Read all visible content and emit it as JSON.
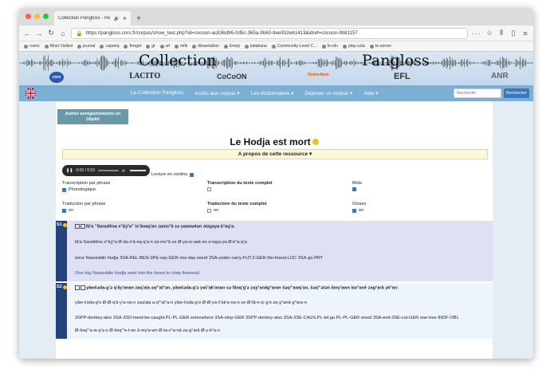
{
  "browser": {
    "tab_title": "Collection Pangloss - Ressource",
    "url": "https://pangloss.cnrs.fr/corpus/show_text.php?id=cocoon-ac836d96-0d5c-365a-9b60-8ee932e61413&idref=cocoon-9b81157",
    "bookmarks": [
      "nums",
      "Most Visited",
      "journal",
      "capoeq",
      "frmget",
      "gr",
      "wf",
      "milk",
      "dissertation",
      "Emoji",
      "katakana",
      "Community-Level C...",
      "fs-rdu",
      "play-uzla",
      "to-server"
    ]
  },
  "banner": {
    "title_left": "Collection",
    "title_right": "Pangloss",
    "logos": [
      "cnrs",
      "LACITO",
      "CoCoON",
      "Huma-Num",
      "EFL",
      "ANR"
    ]
  },
  "menu": {
    "items": [
      "La Collection Pangloss",
      "Accès aux corpus ▾",
      "Les dictionnaires ▾",
      "Déposer un corpus ▾",
      "Aide ▾"
    ],
    "search_placeholder": "Recherche",
    "search_button": "Rechercher"
  },
  "content": {
    "other_recordings": "Autres enregistrements en Ubykh",
    "title": "Le Hodja est mort",
    "apropos": "A propos de cette ressource ▾",
    "player_time": "0:00 / 0:03",
    "continuous": "Lecture en continu",
    "options": {
      "transcription_phrase": "Transcription par phrase",
      "phonologique": "Phonologique",
      "transcription_texte": "Transcription du texte complet",
      "mots": "Mots",
      "traduction_phrase": "Traduction par phrase",
      "en1": "en",
      "traduction_texte": "Traduction du texte complet",
      "en2": "en",
      "gloses": "Gloses",
      "en3": "en"
    }
  },
  "sentences": [
    {
      "num": "S1",
      "main": "fā'a \"Saradēna x°āʒ°a\" tx'ānaq'an zams°ā sə yawawtən ǝtaχaya k°aq'a.",
      "words": "fā'a Saradēna x°āʒ°a Ø-da-x'ā-nq-q'a-n            za-ms°ā sə    Ø-ya-w-awt-ən                 ǝ-taχa-ya          Ø-k°a-q'a",
      "gloss": "once  Nasreddin hodja   3SA-REL-BEN-3PE-say-GER one-day  wood 3SA-under-carry-FUT.2-GER the-forest-LOC 3SA-go-PRT",
      "trans": "One day Nasreddin Hodja went into the forest to chop firewood."
    },
    {
      "num": "S2",
      "main": "yǎwčəda-g'ə q'āy'anan zaq'ala əq°'at°ən, yǎwčəda-g'ə yač'ak'anan sə fānq'g'ə zaχ°anāg°aran šəq°'awq'an, šəq°'ətən āmy'awn lax°anē zag°arā yk°an:",
      "words": "yǎw-čəda-g'ə          Ø-Ø-q'ā-y'a-na-n                     zaq'ala          a-q°'at°a-n       yǎw-čəda-g'ə       Ø-Ø-ya-č'ak'a-na-n                        sə         Ø-fā-n-q'-g'ə         za-χ°anā-g°ara-n",
      "gloss": "3SPP-donkey-also 3SA-3SD-hand-be-caught.PL-PL-GER somewhere 3SA-stop-GER 3SPP-donkey-also 3SA-3SE-CAUS.PL-let.go.PL-PL-GER wood 3SA-end-3SE-cut-GER one-tree-INDF-OBL",
      "words2": "Ø-šəq°'a-w-q'a-n                Ø-šəq°'ə-t-ən              ā-my'a-wn             Ø-la-x°a-nā                  za-g°arā  Ø-y-k°a-n"
    }
  ]
}
